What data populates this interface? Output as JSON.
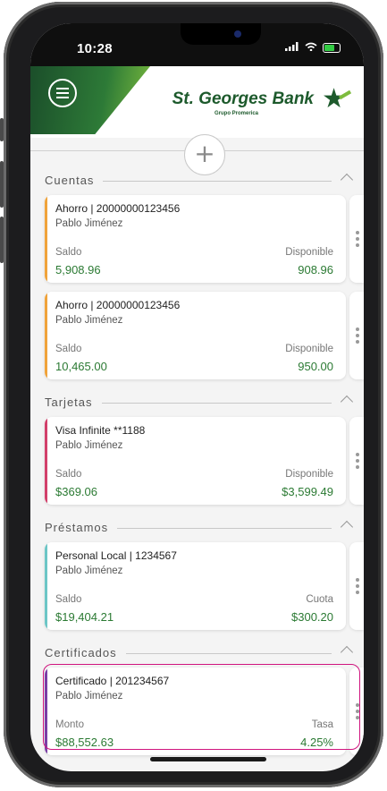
{
  "status_bar": {
    "time": "10:28"
  },
  "header": {
    "brand": "St. Georges Bank",
    "brand_sub": "Grupo Promerica"
  },
  "colors": {
    "brand_green": "#1d5a2c",
    "amount_green": "#2b7a33",
    "highlight": "#d0157f"
  },
  "sections": [
    {
      "title": "Cuentas"
    },
    {
      "title": "Tarjetas"
    },
    {
      "title": "Préstamos"
    },
    {
      "title": "Certificados"
    }
  ],
  "cards": [
    {
      "title": "Ahorro | 20000000123456",
      "owner": "Pablo Jiménez",
      "label_left": "Saldo",
      "value_left": "5,908.96",
      "label_right": "Disponible",
      "value_right": "908.96",
      "accent": "#f0a33a"
    },
    {
      "title": "Ahorro | 20000000123456",
      "owner": "Pablo Jiménez",
      "label_left": "Saldo",
      "value_left": "10,465.00",
      "label_right": "Disponible",
      "value_right": "950.00",
      "accent": "#f0a33a"
    },
    {
      "title": "Visa Infinite **1188",
      "owner": "Pablo Jiménez",
      "label_left": "Saldo",
      "value_left": "$369.06",
      "label_right": "Disponible",
      "value_right": "$3,599.49",
      "accent": "#d23f6a"
    },
    {
      "title": "Personal Local | 1234567",
      "owner": "Pablo Jiménez",
      "label_left": "Saldo",
      "value_left": "$19,404.21",
      "label_right": "Cuota",
      "value_right": "$300.20",
      "accent": "#6cc6c6"
    },
    {
      "title": "Certificado | 201234567",
      "owner": "Pablo Jiménez",
      "label_left": "Monto",
      "value_left": "$88,552.63",
      "label_right": "Tasa",
      "value_right": "4.25%",
      "accent": "#7b3fa6"
    }
  ]
}
